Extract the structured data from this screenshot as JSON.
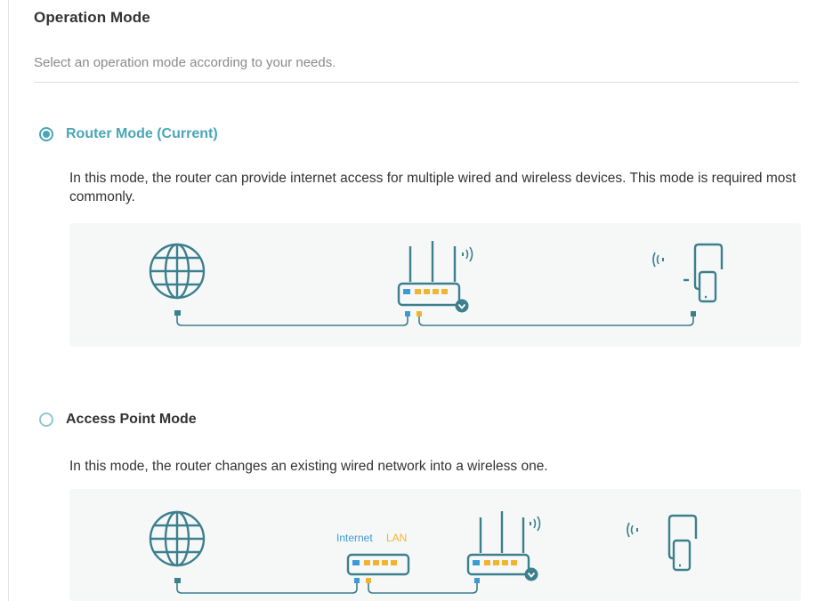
{
  "header": {
    "title": "Operation Mode",
    "subtitle": "Select an operation mode according to your needs."
  },
  "modes": [
    {
      "label": "Router Mode (Current)",
      "selected": true,
      "description": "In this mode, the router can provide internet access for multiple wired and wireless devices. This mode is required most commonly."
    },
    {
      "label": "Access Point Mode",
      "selected": false,
      "description": "In this mode, the router changes an existing wired network into a wireless one.",
      "diagram_labels": {
        "internet": "Internet",
        "lan": "LAN"
      }
    }
  ],
  "colors": {
    "accent": "#4aa6b8",
    "diagram_line": "#3c7f8d",
    "wan_port": "#3b9ad6",
    "lan_port": "#f0b52f"
  },
  "icons": {
    "internet": "globe-icon",
    "router": "router-icon",
    "switch": "switch-icon",
    "devices": "tablet-phone-icon",
    "wifi": "wifi-signal-icon"
  }
}
